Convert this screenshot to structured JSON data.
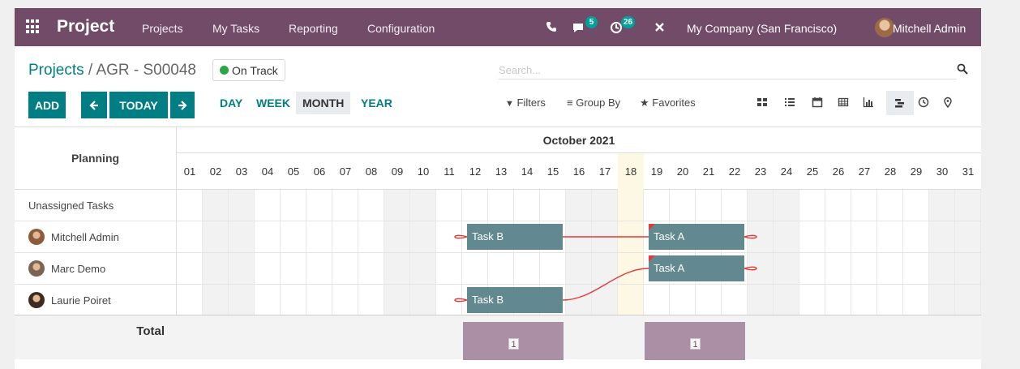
{
  "navbar": {
    "app_name": "Project",
    "menu": [
      "Projects",
      "My Tasks",
      "Reporting",
      "Configuration"
    ],
    "messages_count": "5",
    "activities_count": "26",
    "company": "My Company (San Francisco)",
    "user": "Mitchell Admin",
    "color": "#714b67"
  },
  "breadcrumb": {
    "parent": "Projects",
    "separator": " / ",
    "current": "AGR - S00048"
  },
  "status": {
    "label": "On Track",
    "color": "#28a745"
  },
  "search": {
    "placeholder": "Search..."
  },
  "toolbar": {
    "add_label": "ADD",
    "today_label": "TODAY",
    "scales": [
      "DAY",
      "WEEK",
      "MONTH",
      "YEAR"
    ],
    "active_scale": "MONTH",
    "filters_label": "Filters",
    "groupby_label": "Group By",
    "favorites_label": "Favorites",
    "views": [
      "kanban-icon",
      "list-icon",
      "calendar-icon",
      "pivot-icon",
      "graph-icon",
      "gantt-icon",
      "activity-icon",
      "map-icon"
    ],
    "accent": "#017e84"
  },
  "gantt": {
    "planning_label": "Planning",
    "month_label": "October 2021",
    "days": [
      "01",
      "02",
      "03",
      "04",
      "05",
      "06",
      "07",
      "08",
      "09",
      "10",
      "11",
      "12",
      "13",
      "14",
      "15",
      "16",
      "17",
      "18",
      "19",
      "20",
      "21",
      "22",
      "23",
      "24",
      "25",
      "26",
      "27",
      "28",
      "29",
      "30",
      "31"
    ],
    "today": "18",
    "rows": [
      {
        "name": "Unassigned Tasks",
        "avatar": false
      },
      {
        "name": "Mitchell Admin",
        "avatar": true
      },
      {
        "name": "Marc Demo",
        "avatar": true
      },
      {
        "name": "Laurie Poiret",
        "avatar": true
      }
    ],
    "tasks": [
      {
        "name": "Task B",
        "row": 1,
        "start": "12",
        "end": "15",
        "late": false
      },
      {
        "name": "Task A",
        "row": 1,
        "start": "19",
        "end": "22",
        "late": true
      },
      {
        "name": "Task A",
        "row": 2,
        "start": "19",
        "end": "22",
        "late": true
      },
      {
        "name": "Task B",
        "row": 3,
        "start": "12",
        "end": "15",
        "late": false
      }
    ],
    "total_label": "Total",
    "totals": [
      {
        "start": "12",
        "end": "15",
        "count": "1"
      },
      {
        "start": "19",
        "end": "22",
        "count": "1"
      }
    ],
    "task_color": "#62898f",
    "total_color": "#aa8fa5",
    "connector_color": "#e53935"
  }
}
